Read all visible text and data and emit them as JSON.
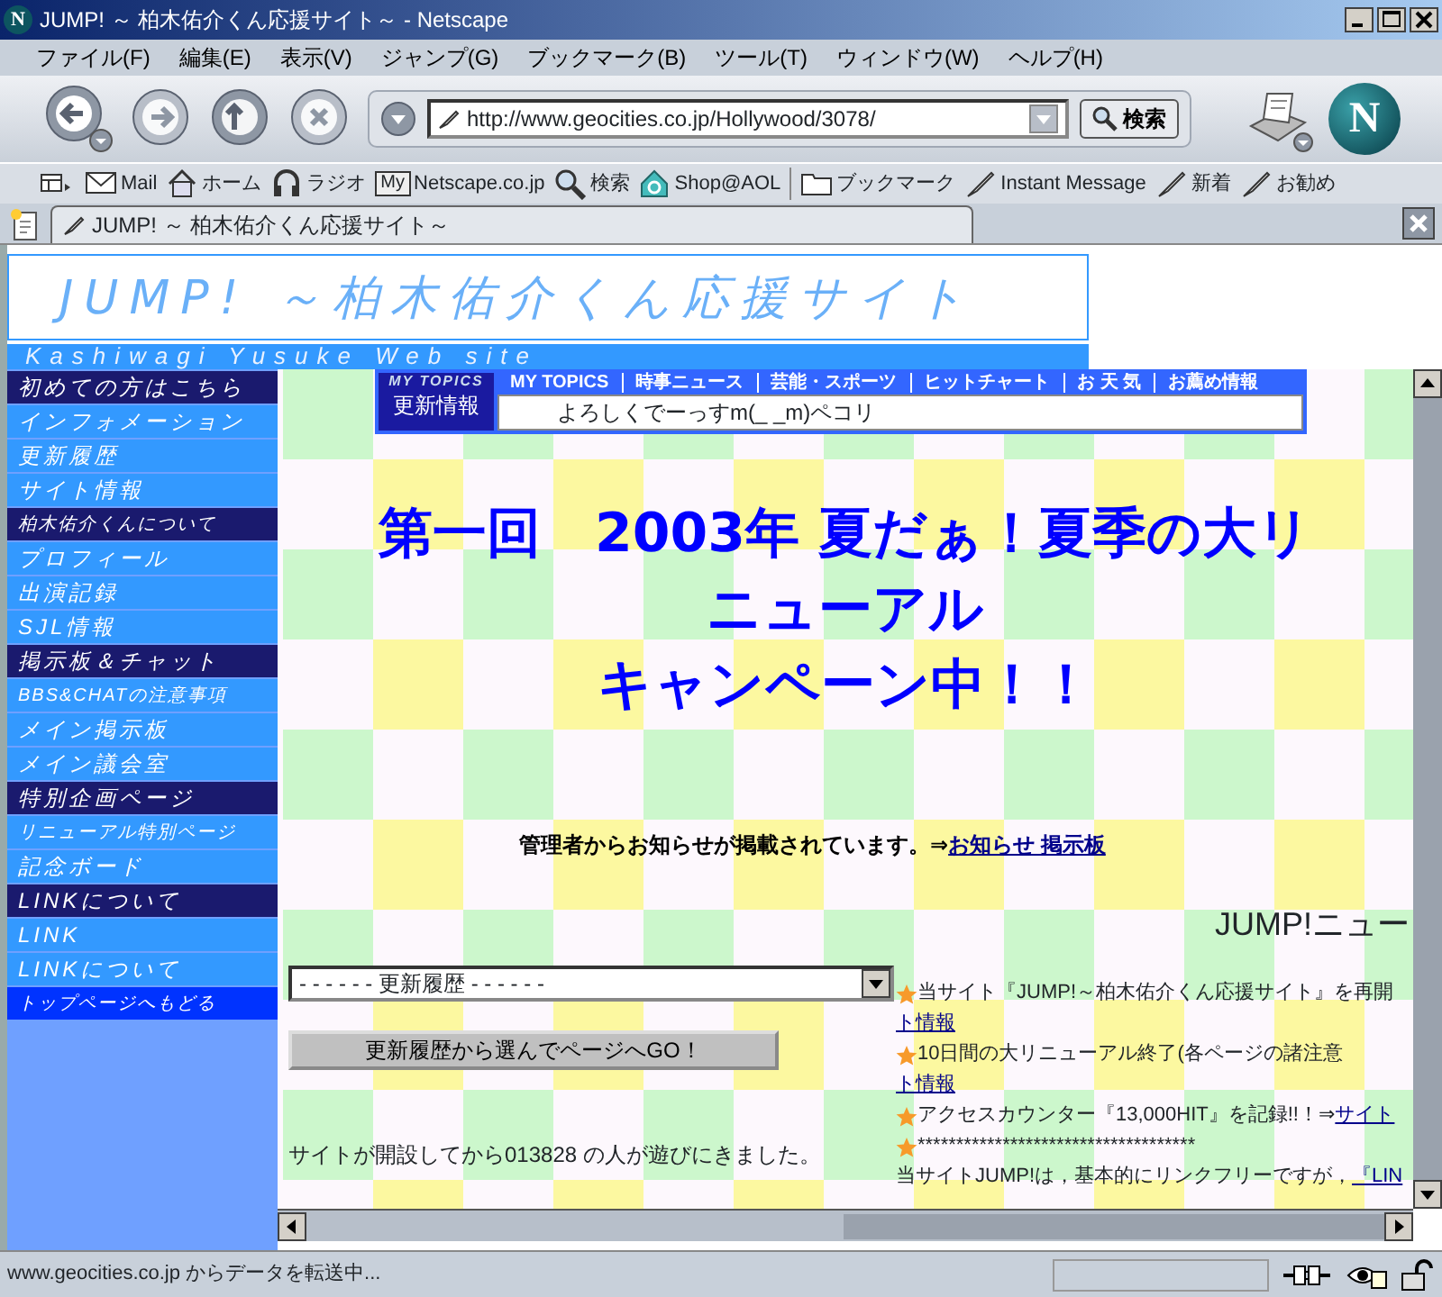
{
  "window": {
    "icon_letter": "N",
    "title": "JUMP! ～ 柏木佑介くん応援サイト～ - Netscape"
  },
  "menu": [
    "ファイル(F)",
    "編集(E)",
    "表示(V)",
    "ジャンプ(G)",
    "ブックマーク(B)",
    "ツール(T)",
    "ウィンドウ(W)",
    "ヘルプ(H)"
  ],
  "navigation": {
    "url": "http://www.geocities.co.jp/Hollywood/3078/",
    "search_button": "検索",
    "logo_letter": "N"
  },
  "personal_toolbar": [
    {
      "kind": "mail",
      "label": "Mail"
    },
    {
      "kind": "home",
      "label": "ホーム"
    },
    {
      "kind": "radio",
      "label": "ラジオ"
    },
    {
      "kind": "my",
      "badge": "My",
      "label": "Netscape.co.jp"
    },
    {
      "kind": "search",
      "label": "検索"
    },
    {
      "kind": "shop",
      "label": "Shop@AOL"
    },
    {
      "kind": "folder",
      "label": "ブックマーク"
    },
    {
      "kind": "bookmark",
      "label": "Instant Message"
    },
    {
      "kind": "bookmark",
      "label": "新着"
    },
    {
      "kind": "bookmark",
      "label": "お勧め"
    }
  ],
  "tabs": [
    {
      "title": "JUMP! ～ 柏木佑介くん応援サイト～",
      "selected": true
    }
  ],
  "site": {
    "banner_title": "JUMP! ～柏木佑介くん応援サイト",
    "banner_subtitle": "Kashiwagi Yusuke Web site",
    "sidebar": [
      {
        "kind": "heading",
        "label": "初めての方はこちら"
      },
      {
        "kind": "link",
        "label": "インフォメーション"
      },
      {
        "kind": "link",
        "label": "更新履歴"
      },
      {
        "kind": "link",
        "label": "サイト情報"
      },
      {
        "kind": "heading",
        "label": "柏木佑介くんについて"
      },
      {
        "kind": "link",
        "label": "プロフィール"
      },
      {
        "kind": "link",
        "label": "出演記録"
      },
      {
        "kind": "link",
        "label": "SJL情報"
      },
      {
        "kind": "heading",
        "label": "掲示板＆チャット"
      },
      {
        "kind": "link",
        "label": "BBS&CHATの注意事項"
      },
      {
        "kind": "link",
        "label": "メイン掲示板"
      },
      {
        "kind": "link",
        "label": "メイン議会室"
      },
      {
        "kind": "heading",
        "label": "特別企画ページ"
      },
      {
        "kind": "link",
        "label": "リニューアル特別ページ"
      },
      {
        "kind": "link",
        "label": "記念ボード"
      },
      {
        "kind": "heading",
        "label": "LINKについて"
      },
      {
        "kind": "link",
        "label": "LINK"
      },
      {
        "kind": "link",
        "label": "LINKについて"
      },
      {
        "kind": "top",
        "label": "トップページへもどる"
      }
    ],
    "topics": {
      "badge": "MY TOPICS",
      "label": "更新情報",
      "tabs": [
        "MY TOPICS",
        "時事ニュース",
        "芸能・スポーツ",
        "ヒットチャート",
        "お 天 気",
        "お薦め情報"
      ],
      "message": "よろしくでーっすm(_ _m)ペコリ"
    },
    "headline": [
      "第一回　2003年 夏だぁ！夏季の大リ",
      "ニューアル",
      "キャンペーン中！！"
    ],
    "notice": {
      "text": "管理者からお知らせが掲載されています。⇒",
      "link": "お知らせ 掲示板"
    },
    "history_select": "- - - - - - 更新履歴 - - - - - -",
    "go_button": "更新履歴から選んでページへGO！",
    "counter": "サイトが開設してから013828 の人が遊びにきました。",
    "news_title": "JUMP!ニュー",
    "news": [
      {
        "star": true,
        "text": "当サイト『JUMP!～柏木佑介くん応援サイト』を再開",
        "link": "ト情報",
        "link_on_new_line": true
      },
      {
        "star": true,
        "text": "10日間の大リニューアル終了(各ページの諸注意",
        "link": "ト情報",
        "link_on_new_line": true
      },
      {
        "star": true,
        "text": "アクセスカウンター『13,000HIT』を記録!!！⇒",
        "link": "サイト",
        "link_on_new_line": false
      },
      {
        "star": true,
        "text": "************************************"
      },
      {
        "star": false,
        "text": "当サイトJUMP!は，基本的にリンクフリーですが，",
        "link": "『LIN",
        "link_on_new_line": false
      }
    ]
  },
  "status_bar": {
    "text": "www.geocities.co.jp からデータを転送中..."
  }
}
